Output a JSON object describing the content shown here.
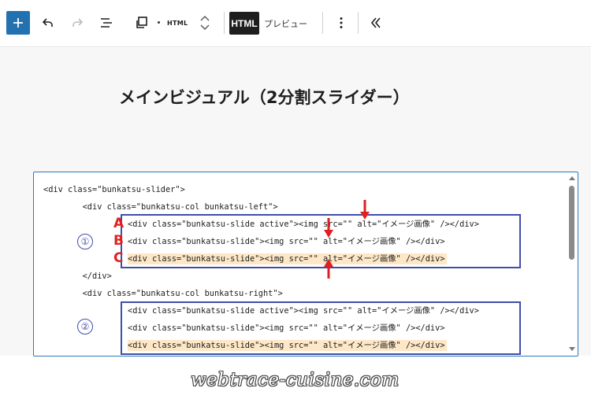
{
  "toolbar": {
    "html_small_label": "HTML",
    "html_tab_label": "HTML",
    "preview_tab_label": "プレビュー"
  },
  "heading": {
    "title": "メインビジュアル（2分割スライダー）"
  },
  "code": {
    "lines": [
      "<div class=\"bunkatsu-slider\">",
      "        <div class=\"bunkatsu-col bunkatsu-left\">",
      "<div class=\"bunkatsu-slide active\"><img src=\"\" alt=\"イメージ画像\" /></div>",
      "<div class=\"bunkatsu-slide\"><img src=\"\" alt=\"イメージ画像\" /></div>",
      "<div class=\"bunkatsu-slide\"><img src=\"\" alt=\"イメージ画像\" /></div>",
      "        </div>",
      "        <div class=\"bunkatsu-col bunkatsu-right\">",
      "<div class=\"bunkatsu-slide active\"><img src=\"\" alt=\"イメージ画像\" /></div>",
      "<div class=\"bunkatsu-slide\"><img src=\"\" alt=\"イメージ画像\" /></div>",
      "<div class=\"bunkatsu-slide\"><img src=\"\" alt=\"イメージ画像\" /></div>"
    ]
  },
  "annotations": {
    "group1_label": "①",
    "group2_label": "②",
    "letter_a": "A",
    "letter_b": "B",
    "letter_c": "C",
    "box_color": "#3f4ea8",
    "arrow_color": "#e02020",
    "highlight_color": "#fde7c6"
  },
  "watermark": {
    "text": "webtrace-cuisine.com"
  },
  "colors": {
    "accent": "#2271b1",
    "focus_border": "#2e78b7"
  }
}
